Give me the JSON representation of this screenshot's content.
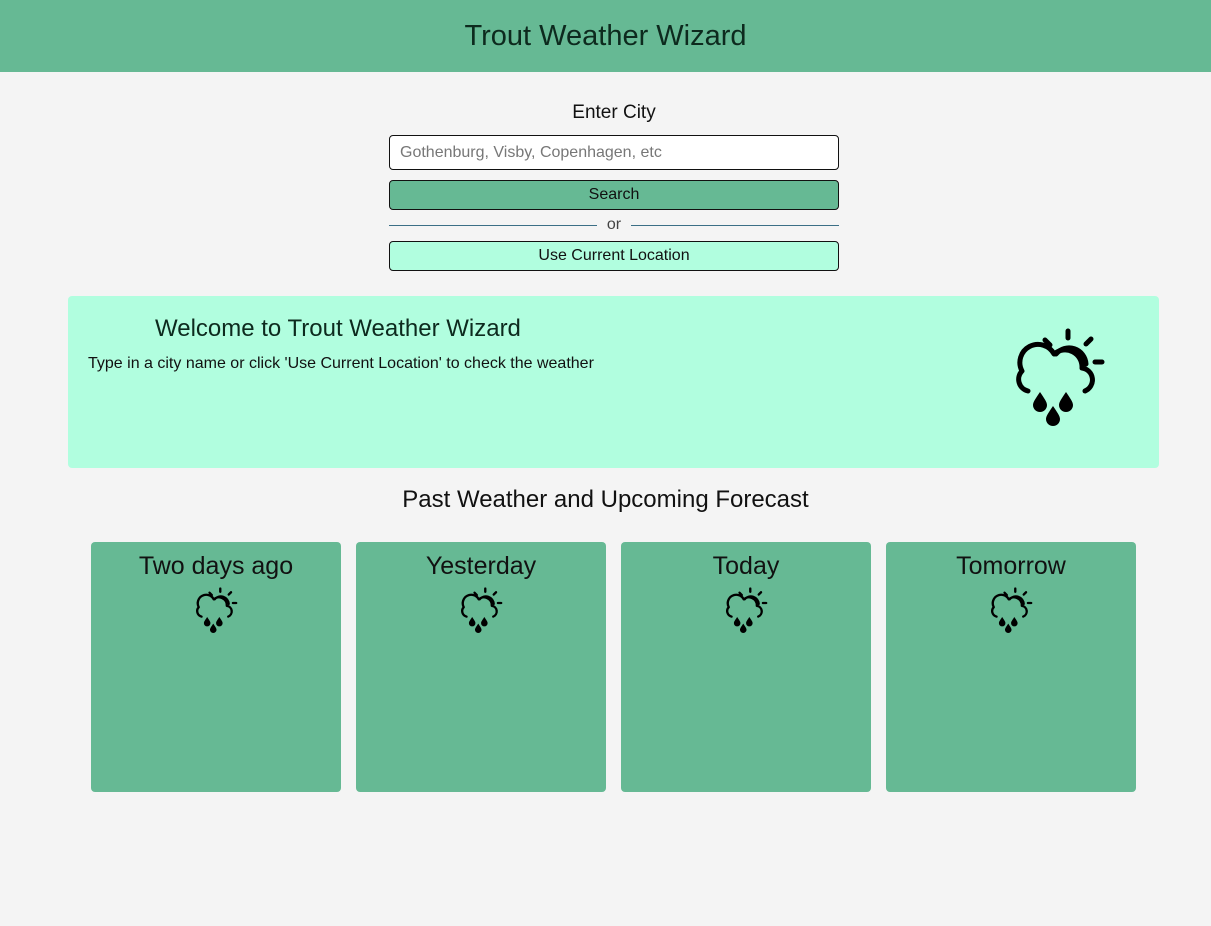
{
  "header": {
    "title": "Trout Weather Wizard"
  },
  "search": {
    "label": "Enter City",
    "placeholder": "Gothenburg, Visby, Copenhagen, etc",
    "value": "",
    "search_button": "Search",
    "divider_text": "or",
    "location_button": "Use Current Location"
  },
  "welcome": {
    "title": "Welcome to Trout Weather Wizard",
    "message": "Type in a city name or click 'Use Current Location' to check the weather",
    "icon": "partly-cloudy-rain-icon"
  },
  "forecast": {
    "title": "Past Weather and Upcoming Forecast",
    "cards": [
      {
        "label": "Two days ago",
        "icon": "partly-cloudy-rain-icon"
      },
      {
        "label": "Yesterday",
        "icon": "partly-cloudy-rain-icon"
      },
      {
        "label": "Today",
        "icon": "partly-cloudy-rain-icon"
      },
      {
        "label": "Tomorrow",
        "icon": "partly-cloudy-rain-icon"
      }
    ]
  },
  "colors": {
    "header_bg": "#66b994",
    "page_bg": "#f4f4f4",
    "welcome_bg": "#b1fedf",
    "card_bg": "#66b994",
    "accent_button": "#66b994",
    "location_button": "#b1fedf"
  }
}
